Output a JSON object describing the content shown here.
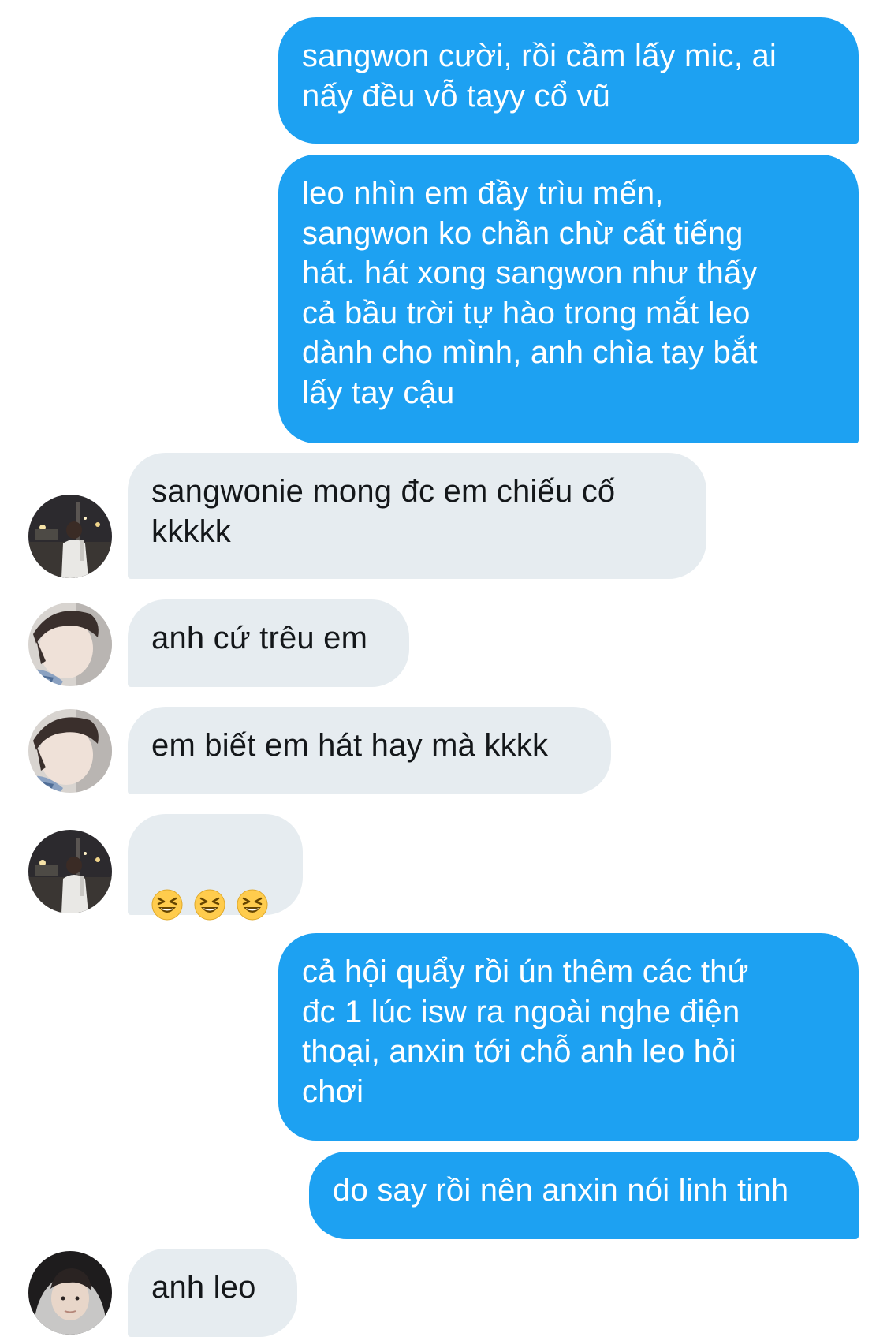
{
  "conversation": {
    "messages": [
      {
        "direction": "outgoing",
        "text": "sangwon cười, rồi cầm lấy mic, ai\nnấy đều vỗ tayy cổ vũ"
      },
      {
        "direction": "outgoing",
        "text": "leo nhìn em đầy trìu mến,\nsangwon ko chần chừ cất tiếng\nhát. hát xong sangwon như thấy\ncả bầu trời tự hào trong mắt leo\ndành cho mình, anh chìa tay bắt\nlấy tay cậu"
      },
      {
        "direction": "incoming",
        "avatar": "avatar-night-street",
        "text": "sangwonie mong đc em chiếu cố\nkkkkk"
      },
      {
        "direction": "incoming",
        "avatar": "avatar-selfie",
        "text": "anh cứ trêu em"
      },
      {
        "direction": "incoming",
        "avatar": "avatar-selfie",
        "text": "em biết em hát hay mà kkkk"
      },
      {
        "direction": "incoming",
        "avatar": "avatar-night-street",
        "emoji": [
          "grinning-squinting-face-icon",
          "grinning-squinting-face-icon",
          "grinning-squinting-face-icon"
        ]
      },
      {
        "direction": "outgoing",
        "text": "cả hội quẩy rồi ún thêm các thứ\nđc 1 lúc isw ra ngoài nghe điện\nthoại, anxin tới chỗ anh leo hỏi\nchơi"
      },
      {
        "direction": "outgoing",
        "text": "do say rồi nên anxin nói linh tinh"
      },
      {
        "direction": "incoming",
        "avatar": "avatar-hoodie",
        "text": "anh leo"
      }
    ]
  },
  "colors": {
    "outgoing_bubble": "#1da1f2",
    "incoming_bubble": "#e6ecf0",
    "incoming_text": "#14171a",
    "outgoing_text": "#ffffff"
  }
}
